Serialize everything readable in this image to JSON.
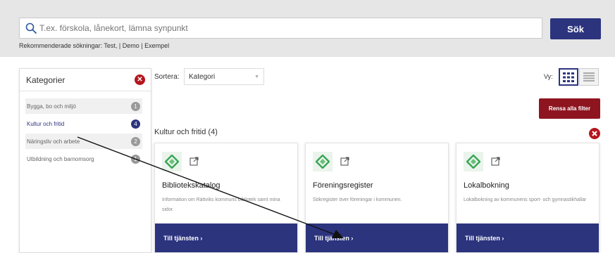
{
  "search": {
    "placeholder": "T.ex. förskola, lånekort, lämna synpunkt",
    "button_label": "Sök",
    "suggestions": "Rekommenderade sökningar: Test, | Demo | Exempel"
  },
  "sidebar": {
    "title": "Kategorier",
    "clear_glyph": "✕",
    "categories": [
      {
        "label": "Bygga, bo och miljö",
        "count": "1"
      },
      {
        "label": "Kultur och fritid",
        "count": "4"
      },
      {
        "label": "Näringsliv och arbete",
        "count": "2"
      },
      {
        "label": "Utbildning och barnomsorg",
        "count": "1"
      }
    ]
  },
  "toolbar": {
    "sort_label": "Sortera:",
    "sort_value": "Kategori",
    "view_label": "Vy:",
    "clear_filters_label": "Rensa alla filter"
  },
  "section": {
    "title": "Kultur och fritid (4)"
  },
  "cards": [
    {
      "title": "Bibliotekskatalog",
      "description": "Information om Rättviks kommuns bibliotek samt mina sidor.",
      "cta": "Till tjänsten ›"
    },
    {
      "title": "Föreningsregister",
      "description": "Sökregister över föreningar i kommunen.",
      "cta": "Till tjänsten ›"
    },
    {
      "title": "Lokalbokning",
      "description": "Lokalbokning av kommunens sport- och gymnastikhallar",
      "cta": "Till tjänsten ›"
    }
  ],
  "colors": {
    "brand_navy": "#2c347e",
    "danger_red": "#b5161e",
    "clear_button": "#8e1520",
    "icon_green": "#3aa556"
  },
  "icons": {
    "search": "magnifier-icon",
    "external": "external-link-icon",
    "service": "diamond-logo-icon"
  }
}
